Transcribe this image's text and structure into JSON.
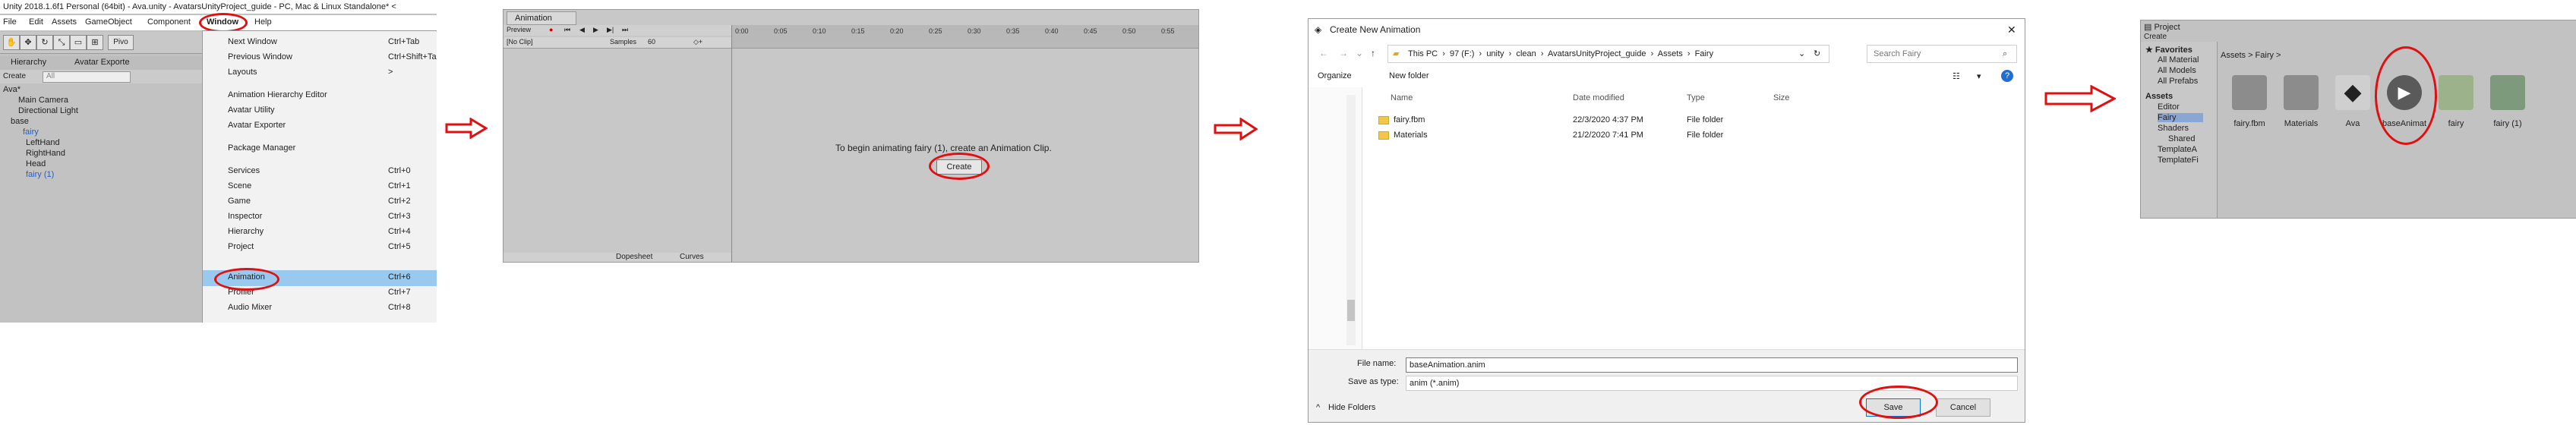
{
  "colors": {
    "unity_panel": "#c2c2c2",
    "menu_highlight": "#99c9ef",
    "annotation_red": "#e01010",
    "folder_yellow": "#f3c64a",
    "win_bg": "#ffffff"
  },
  "panel1": {
    "title": "Unity 2018.1.6f1 Personal (64bit) - Ava.unity - AvatarsUnityProject_guide - PC, Mac & Linux Standalone* <",
    "menubar": [
      "File",
      "Edit",
      "Assets",
      "GameObject",
      "Component",
      "Window",
      "Help"
    ],
    "toolbar_pivot": "Pivo",
    "hierarchy_tabs": [
      "Hierarchy",
      "Avatar Exporte"
    ],
    "create_label": "Create",
    "search_placeholder": "All",
    "scene": "Ava*",
    "hierarchy_items": [
      "Main Camera",
      "Directional Light",
      "base",
      "fairy",
      "LeftHand",
      "RightHand",
      "Head",
      "fairy (1)"
    ],
    "menu": [
      {
        "label": "Next Window",
        "shortcut": "Ctrl+Tab"
      },
      {
        "label": "Previous Window",
        "shortcut": "Ctrl+Shift+Tab"
      },
      {
        "label": "Layouts",
        "shortcut": ">"
      },
      {
        "label": "Animation Hierarchy Editor",
        "shortcut": ""
      },
      {
        "label": "Avatar Utility",
        "shortcut": ""
      },
      {
        "label": "Avatar Exporter",
        "shortcut": ""
      },
      {
        "label": "Package Manager",
        "shortcut": ""
      },
      {
        "label": "Services",
        "shortcut": "Ctrl+0"
      },
      {
        "label": "Scene",
        "shortcut": "Ctrl+1"
      },
      {
        "label": "Game",
        "shortcut": "Ctrl+2"
      },
      {
        "label": "Inspector",
        "shortcut": "Ctrl+3"
      },
      {
        "label": "Hierarchy",
        "shortcut": "Ctrl+4"
      },
      {
        "label": "Project",
        "shortcut": "Ctrl+5"
      },
      {
        "label": "Animation",
        "shortcut": "Ctrl+6"
      },
      {
        "label": "Profiler",
        "shortcut": "Ctrl+7"
      },
      {
        "label": "Audio Mixer",
        "shortcut": "Ctrl+8"
      }
    ]
  },
  "panel2": {
    "tab": "Animation",
    "preview": "Preview",
    "clip_dropdown": "[No Clip]",
    "samples_label": "Samples",
    "samples_value": "60",
    "ticks": [
      "0:00",
      "0:05",
      "0:10",
      "0:15",
      "0:20",
      "0:25",
      "0:30",
      "0:35",
      "0:40",
      "0:45",
      "0:50",
      "0:55"
    ],
    "message": "To begin animating fairy (1), create an Animation Clip.",
    "create_button": "Create",
    "bottom_tabs": [
      "Dopesheet",
      "Curves"
    ]
  },
  "panel3": {
    "title": "Create New Animation",
    "path": [
      "This PC",
      "97 (F:)",
      "unity",
      "clean",
      "AvatarsUnityProject_guide",
      "Assets",
      "Fairy"
    ],
    "search_placeholder": "Search Fairy",
    "organize": "Organize",
    "new_folder": "New folder",
    "columns": [
      "Name",
      "Date modified",
      "Type",
      "Size"
    ],
    "files": [
      {
        "name": "fairy.fbm",
        "date": "22/3/2020 4:37 PM",
        "type": "File folder"
      },
      {
        "name": "Materials",
        "date": "21/2/2020 7:41 PM",
        "type": "File folder"
      }
    ],
    "file_name_label": "File name:",
    "file_name_value": "baseAnimation.anim",
    "save_type_label": "Save as type:",
    "save_type_value": "anim (*.anim)",
    "hide_folders": "Hide Folders",
    "save_button": "Save",
    "cancel_button": "Cancel"
  },
  "panel4": {
    "tab": "Project",
    "create_label": "Create",
    "favorites": "Favorites",
    "fav_items": [
      "All Material",
      "All Models",
      "All Prefabs"
    ],
    "assets": "Assets",
    "tree_items": [
      "Editor",
      "Fairy",
      "Shaders",
      "Shared",
      "TemplateA",
      "TemplateFi"
    ],
    "breadcrumb": "Assets > Fairy >",
    "items": [
      "fairy.fbm",
      "Materials",
      "Ava",
      "baseAnimat",
      "fairy",
      "fairy (1)"
    ]
  }
}
